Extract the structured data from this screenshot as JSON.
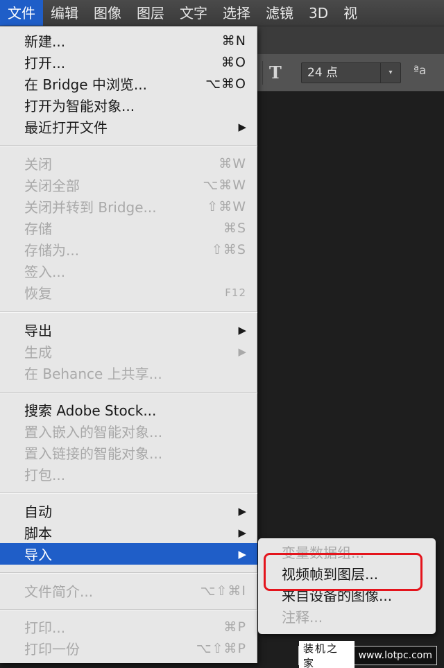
{
  "menubar": {
    "items": [
      "文件",
      "编辑",
      "图像",
      "图层",
      "文字",
      "选择",
      "滤镜",
      "3D",
      "视"
    ]
  },
  "toolbar": {
    "font_size": "24 点",
    "dropdown_arrow": "▾",
    "text_orient_icon": "T",
    "antialias_icon": "ªa"
  },
  "file_menu": {
    "items": [
      {
        "label": "新建...",
        "shortcut": "⌘N"
      },
      {
        "label": "打开...",
        "shortcut": "⌘O"
      },
      {
        "label": "在 Bridge 中浏览...",
        "shortcut": "⌥⌘O"
      },
      {
        "label": "打开为智能对象...",
        "shortcut": ""
      },
      {
        "label": "最近打开文件",
        "shortcut": "▶"
      },
      {
        "label": "关闭",
        "shortcut": "⌘W"
      },
      {
        "label": "关闭全部",
        "shortcut": "⌥⌘W"
      },
      {
        "label": "关闭并转到 Bridge...",
        "shortcut": "⇧⌘W"
      },
      {
        "label": "存储",
        "shortcut": "⌘S"
      },
      {
        "label": "存储为...",
        "shortcut": "⇧⌘S"
      },
      {
        "label": "签入...",
        "shortcut": ""
      },
      {
        "label": "恢复",
        "shortcut": "F12"
      },
      {
        "label": "导出",
        "shortcut": "▶"
      },
      {
        "label": "生成",
        "shortcut": "▶"
      },
      {
        "label": "在 Behance 上共享...",
        "shortcut": ""
      },
      {
        "label": "搜索 Adobe Stock...",
        "shortcut": ""
      },
      {
        "label": "置入嵌入的智能对象...",
        "shortcut": ""
      },
      {
        "label": "置入链接的智能对象...",
        "shortcut": ""
      },
      {
        "label": "打包...",
        "shortcut": ""
      },
      {
        "label": "自动",
        "shortcut": "▶"
      },
      {
        "label": "脚本",
        "shortcut": "▶"
      },
      {
        "label": "导入",
        "shortcut": "▶"
      },
      {
        "label": "文件简介...",
        "shortcut": "⌥⇧⌘I"
      },
      {
        "label": "打印...",
        "shortcut": "⌘P"
      },
      {
        "label": "打印一份",
        "shortcut": "⌥⇧⌘P"
      }
    ]
  },
  "import_submenu": {
    "items": [
      {
        "label": "变量数据组..."
      },
      {
        "label": "视频帧到图层..."
      },
      {
        "label": "来自设备的图像..."
      },
      {
        "label": "注释..."
      }
    ]
  },
  "watermark": {
    "site_name": "装机之家",
    "url": "www.lotpc.com"
  },
  "colors": {
    "highlight": "#1f5ec8",
    "annotation_box": "#e4141c",
    "menu_bg": "#e7e7e7",
    "disabled_text": "#a9a9a9"
  }
}
